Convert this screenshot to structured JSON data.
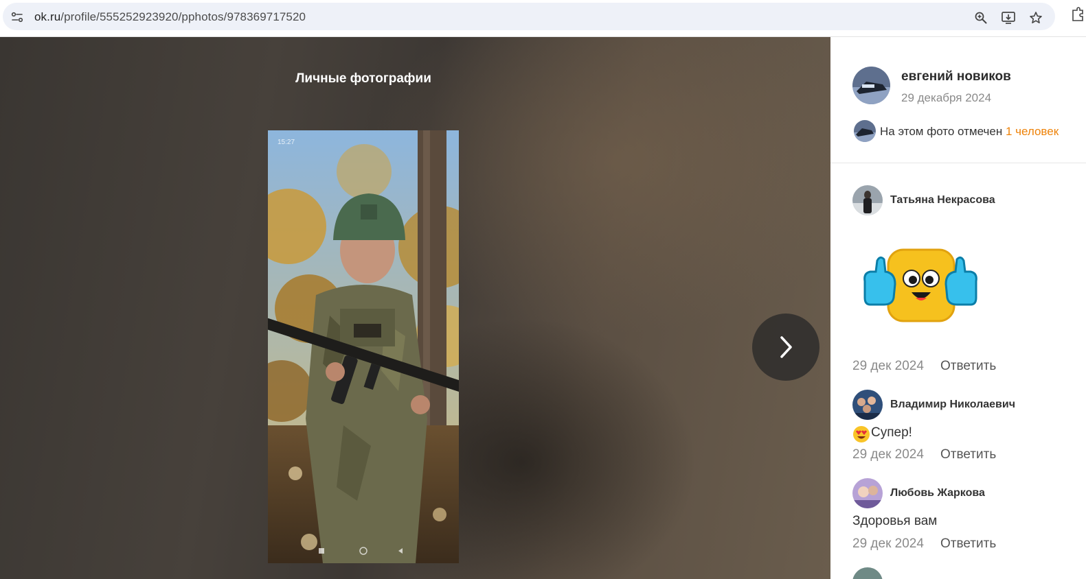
{
  "browser": {
    "url_host": "ok.ru",
    "url_path": "/profile/555252923920/pphotos/978369717520",
    "icons": [
      "site-info-icon",
      "zoom-icon",
      "install-app-icon",
      "bookmark-star-icon",
      "extensions-icon"
    ]
  },
  "viewer": {
    "album_title": "Личные фотографии",
    "photo": {
      "status_time": "15:27",
      "subject": "soldier-in-helmet-holding-rifle"
    },
    "next_icon": "chevron-right-icon"
  },
  "panel": {
    "owner": {
      "name": "евгений новиков",
      "date": "29 декабря 2024"
    },
    "tag": {
      "text": "На этом фото отмечен ",
      "link": "1 человек"
    },
    "comments": [
      {
        "author": "Татьяна Некрасова",
        "sticker": "thumbs-up-face-sticker",
        "date": "29 дек 2024",
        "reply": "Ответить"
      },
      {
        "author": "Владимир Николаевич",
        "emoji": "heart-eyes-emoji",
        "text": "Супер!",
        "date": "29 дек 2024",
        "reply": "Ответить"
      },
      {
        "author": "Любовь Жаркова",
        "text": "Здоровья вам",
        "date": "29 дек 2024",
        "reply": "Ответить"
      }
    ]
  },
  "colors": {
    "link_orange": "#ee8208",
    "omnibox_bg": "#eef1f8",
    "next_button_bg": "#32302e"
  }
}
